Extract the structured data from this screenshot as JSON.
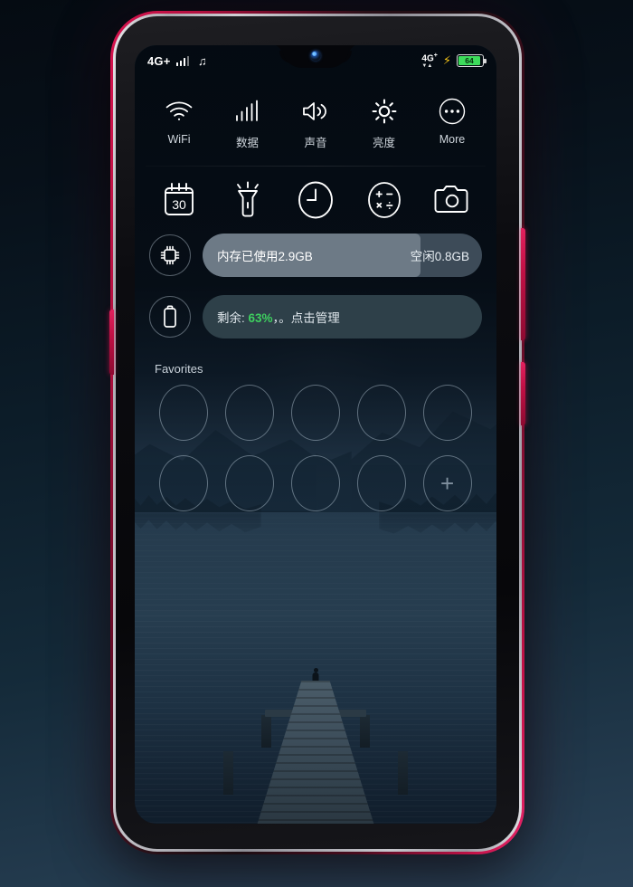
{
  "statusbar": {
    "network": "4G+",
    "signal_icon": "signal-bars-icon",
    "music_icon": "music-note-icon",
    "music_glyph": "♫",
    "data_label": "4G",
    "data_sup": "+",
    "data_arrows": "▼▲",
    "charging_icon": "lightning-bolt-icon",
    "charging_glyph": "⚡",
    "battery_percent": "64"
  },
  "quick_toggles_row1": [
    {
      "label": "WiFi",
      "icon": "wifi-icon"
    },
    {
      "label": "数据",
      "icon": "cellular-data-icon"
    },
    {
      "label": "声音",
      "icon": "sound-volume-icon"
    },
    {
      "label": "亮度",
      "icon": "brightness-icon"
    },
    {
      "label": "More",
      "icon": "more-dots-icon"
    }
  ],
  "shortcuts_row2": [
    {
      "icon": "calendar-icon",
      "label": "30"
    },
    {
      "icon": "flashlight-icon",
      "label": ""
    },
    {
      "icon": "clock-icon",
      "label": ""
    },
    {
      "icon": "calculator-icon",
      "label": ""
    },
    {
      "icon": "camera-icon",
      "label": ""
    }
  ],
  "memory": {
    "icon": "memory-chip-icon",
    "used_label": "内存已使用2.9GB",
    "free_label": "空闲0.8GB",
    "used_gb": 2.9,
    "free_gb": 0.8,
    "fill_percent": 78
  },
  "battery": {
    "icon": "battery-outline-icon",
    "prefix": "剩余: ",
    "percent": "63%",
    "suffix": "，。点击管理",
    "percent_color": "#3ecf5f"
  },
  "favorites": {
    "title": "Favorites",
    "slots": [
      "",
      "",
      "",
      "",
      "",
      "",
      "",
      "",
      "",
      "+"
    ]
  },
  "colors": {
    "accent_green": "#3ecf5f",
    "battery_fill": "#3ddc5b",
    "charge_bolt": "#f5c518",
    "frame": "#d9134f",
    "panel_bg": "#060e17",
    "mem_fill": "#6d7a86",
    "mem_track": "#3d4b58",
    "battery_pill": "#2e4049"
  }
}
